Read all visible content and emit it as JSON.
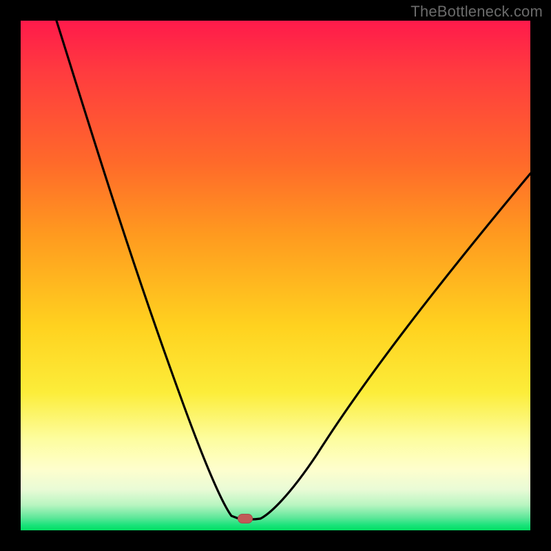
{
  "watermark": "TheBottleneck.com",
  "colors": {
    "frame": "#000000",
    "marker": "#c15a58",
    "curve": "#000000",
    "gradient_stops": [
      "#ff1a4b",
      "#ff3b3f",
      "#ff6a2a",
      "#ff9a1f",
      "#ffd21f",
      "#fced3a",
      "#fdfd9e",
      "#fefecd",
      "#e9fbd6",
      "#b9f5c1",
      "#5fe79a",
      "#19e37a",
      "#03df63"
    ]
  },
  "chart_data": {
    "type": "line",
    "title": "",
    "xlabel": "",
    "ylabel": "",
    "xlim": [
      0,
      100
    ],
    "ylim": [
      0,
      100
    ],
    "note": "x/y values are approximate normalized plot coordinates (0–100) read off the rendered curves; y increases upward (0 = bottom of plot, 100 = top).",
    "marker": {
      "x": 44,
      "y": 2
    },
    "series": [
      {
        "name": "left-branch",
        "x": [
          7,
          10,
          14,
          18,
          22,
          26,
          30,
          33,
          36,
          38,
          40,
          41,
          42
        ],
        "y": [
          100,
          90,
          78,
          66,
          54,
          42,
          30,
          21,
          13,
          8,
          5,
          3.2,
          2.5
        ]
      },
      {
        "name": "flat-minimum",
        "x": [
          42,
          43,
          44,
          45,
          46,
          47
        ],
        "y": [
          2.5,
          2.3,
          2.2,
          2.2,
          2.3,
          2.6
        ]
      },
      {
        "name": "right-branch",
        "x": [
          47,
          50,
          54,
          58,
          63,
          68,
          74,
          80,
          86,
          92,
          98,
          100
        ],
        "y": [
          2.6,
          5,
          10,
          17,
          25,
          33,
          42,
          50,
          57,
          63,
          68,
          70
        ]
      }
    ]
  }
}
